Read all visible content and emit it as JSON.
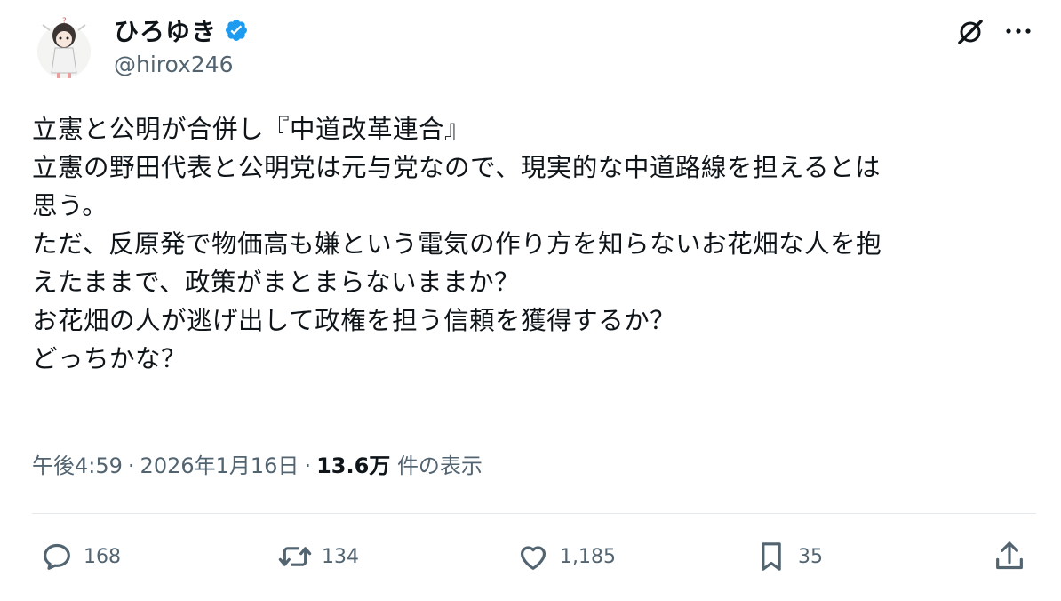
{
  "author": {
    "display_name": "ひろゆき",
    "handle": "@hirox246",
    "verified": true,
    "avatar_icon": "avatar-illustration",
    "verified_color": "#1d9bf0"
  },
  "header_icons": [
    "grok-icon",
    "more-icon"
  ],
  "tweet": {
    "lines": [
      "立憲と公明が合併し『中道改革連合』",
      "立憲の野田代表と公明党は元与党なので、現実的な中道路線を担えるとは",
      "思う。",
      "ただ、反原発で物価高も嫌という電気の作り方を知らないお花畑な人を抱",
      "えたままで、政策がまとまらないままか？",
      "お花畑の人が逃げ出して政権を担う信頼を獲得するか？",
      "どっちかな？"
    ]
  },
  "meta": {
    "time": "午後4:59",
    "date": "2026年1月16日",
    "separator": "·",
    "views_count": "13.6万",
    "views_label": "件の表示"
  },
  "actions": {
    "reply": {
      "icon": "reply-icon",
      "count": "168"
    },
    "retweet": {
      "icon": "retweet-icon",
      "count": "134"
    },
    "like": {
      "icon": "heart-icon",
      "count": "1,185"
    },
    "bookmark": {
      "icon": "bookmark-icon",
      "count": "35"
    },
    "share": {
      "icon": "share-icon"
    }
  },
  "colors": {
    "text": "#0f1419",
    "secondary": "#536471",
    "divider": "#e6e9eb",
    "verified": "#1d9bf0"
  }
}
